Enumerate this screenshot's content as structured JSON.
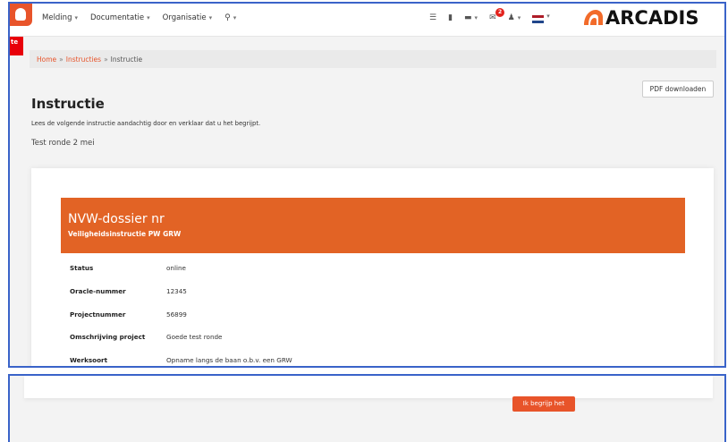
{
  "navbar": {
    "menu": [
      {
        "label": "Melding"
      },
      {
        "label": "Documentatie"
      },
      {
        "label": "Organisatie"
      }
    ],
    "search_icon": "search-icon",
    "message_badge": "2",
    "brand": "ARCADIS",
    "icons": [
      "list-icon",
      "file-icon",
      "comment-icon",
      "mail-icon",
      "user-icon",
      "language-flag-icon"
    ]
  },
  "tag": "te",
  "breadcrumb": [
    "Home",
    "Instructies",
    "Instructie"
  ],
  "pdf_button": "PDF downloaden",
  "page": {
    "title": "Instructie",
    "intro": "Lees de volgende instructie aandachtig door en verklaar dat u het begrijpt.",
    "subtitle": "Test ronde 2 mei"
  },
  "card": {
    "header_title": "NVW-dossier nr",
    "header_subtitle": "Veiligheidsinstructie PW GRW",
    "fields": [
      {
        "label": "Status",
        "value": "online"
      },
      {
        "label": "Oracle-nummer",
        "value": "12345"
      },
      {
        "label": "Projectnummer",
        "value": "56899"
      },
      {
        "label": "Omschrijving project",
        "value": "Goede test ronde"
      },
      {
        "label": "Werksoort",
        "value": "Opname langs de baan o.b.v. een GRW"
      }
    ]
  },
  "confirm_button": "Ik begrijp het",
  "colors": {
    "accent": "#e8542a",
    "header_orange": "#e26325",
    "frame_blue": "#3a63c9"
  }
}
